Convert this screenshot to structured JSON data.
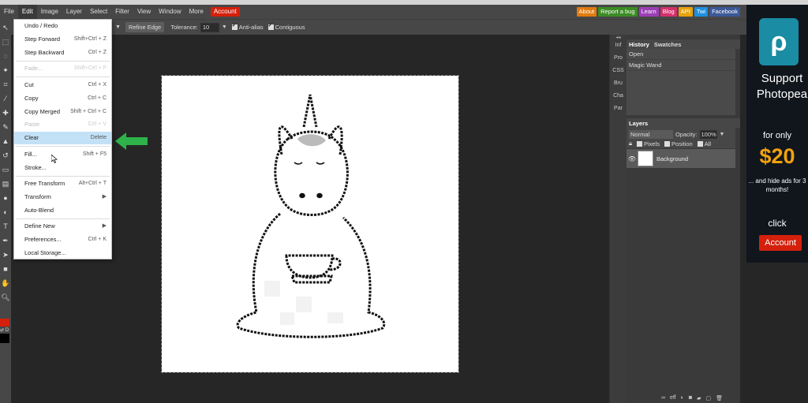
{
  "menubar": {
    "items": [
      "File",
      "Edit",
      "Image",
      "Layer",
      "Select",
      "Filter",
      "View",
      "Window",
      "More"
    ],
    "account": "Account"
  },
  "ext_links": [
    {
      "label": "About",
      "color": "#e07b0f"
    },
    {
      "label": "Report a bug",
      "color": "#3b8c24"
    },
    {
      "label": "Learn",
      "color": "#9b3fb6"
    },
    {
      "label": "Blog",
      "color": "#d4306c"
    },
    {
      "label": "API",
      "color": "#e8a20d"
    },
    {
      "label": "Twi",
      "color": "#1d8fe0"
    },
    {
      "label": "Facebook",
      "color": "#3b5998"
    }
  ],
  "options": {
    "refine_edge": "Refine Edge",
    "tolerance_label": "Tolerance:",
    "tolerance_value": "10",
    "anti_alias": "Anti-alias",
    "contiguous": "Contiguous"
  },
  "edit_menu": [
    {
      "label": "Undo / Redo",
      "shortcut": "",
      "disabled": false
    },
    {
      "label": "Step Forward",
      "shortcut": "Shift+Ctrl + Z",
      "disabled": false
    },
    {
      "label": "Step Backward",
      "shortcut": "Ctrl + Z",
      "disabled": false
    },
    {
      "label": "Fade...",
      "shortcut": "Shift+Ctrl + F",
      "disabled": true
    },
    {
      "label": "Cut",
      "shortcut": "Ctrl + X",
      "disabled": false
    },
    {
      "label": "Copy",
      "shortcut": "Ctrl + C",
      "disabled": false
    },
    {
      "label": "Copy Merged",
      "shortcut": "Shift + Ctrl + C",
      "disabled": false
    },
    {
      "label": "Paste",
      "shortcut": "Ctrl + V",
      "disabled": true
    },
    {
      "label": "Clear",
      "shortcut": "Delete",
      "disabled": false,
      "highlight": true
    },
    {
      "label": "Fill...",
      "shortcut": "Shift + F5",
      "disabled": false
    },
    {
      "label": "Stroke...",
      "shortcut": "",
      "disabled": false
    },
    {
      "label": "Free Transform",
      "shortcut": "Alt+Ctrl + T",
      "disabled": false
    },
    {
      "label": "Transform",
      "shortcut": "▶",
      "disabled": false
    },
    {
      "label": "Auto-Blend",
      "shortcut": "",
      "disabled": false
    },
    {
      "label": "Define New",
      "shortcut": "▶",
      "disabled": false
    },
    {
      "label": "Preferences...",
      "shortcut": "Ctrl + K",
      "disabled": false
    },
    {
      "label": "Local Storage...",
      "shortcut": "",
      "disabled": false
    }
  ],
  "panel_tabs": [
    "Inf",
    "Pro",
    "CSS",
    "Bru",
    "Cha",
    "Par"
  ],
  "history": {
    "tab_history": "History",
    "tab_swatches": "Swatches",
    "items": [
      "Open",
      "Magic Wand"
    ]
  },
  "layers": {
    "title": "Layers",
    "blend_mode": "Normal",
    "opacity_label": "Opacity:",
    "opacity_value": "100%",
    "lock_pixels": "Pixels",
    "lock_position": "Position",
    "lock_all": "All",
    "layer_name": "Background"
  },
  "ad": {
    "support": "Support Photopea",
    "for_only": "for only",
    "price": "$20",
    "hide_ads": "... and hide ads for 3 months!",
    "click": "click",
    "account": "Account"
  },
  "colors": {
    "accent_red": "#d4200c",
    "arrow_green": "#2db34a",
    "menu_highlight": "#c3e1f6"
  }
}
